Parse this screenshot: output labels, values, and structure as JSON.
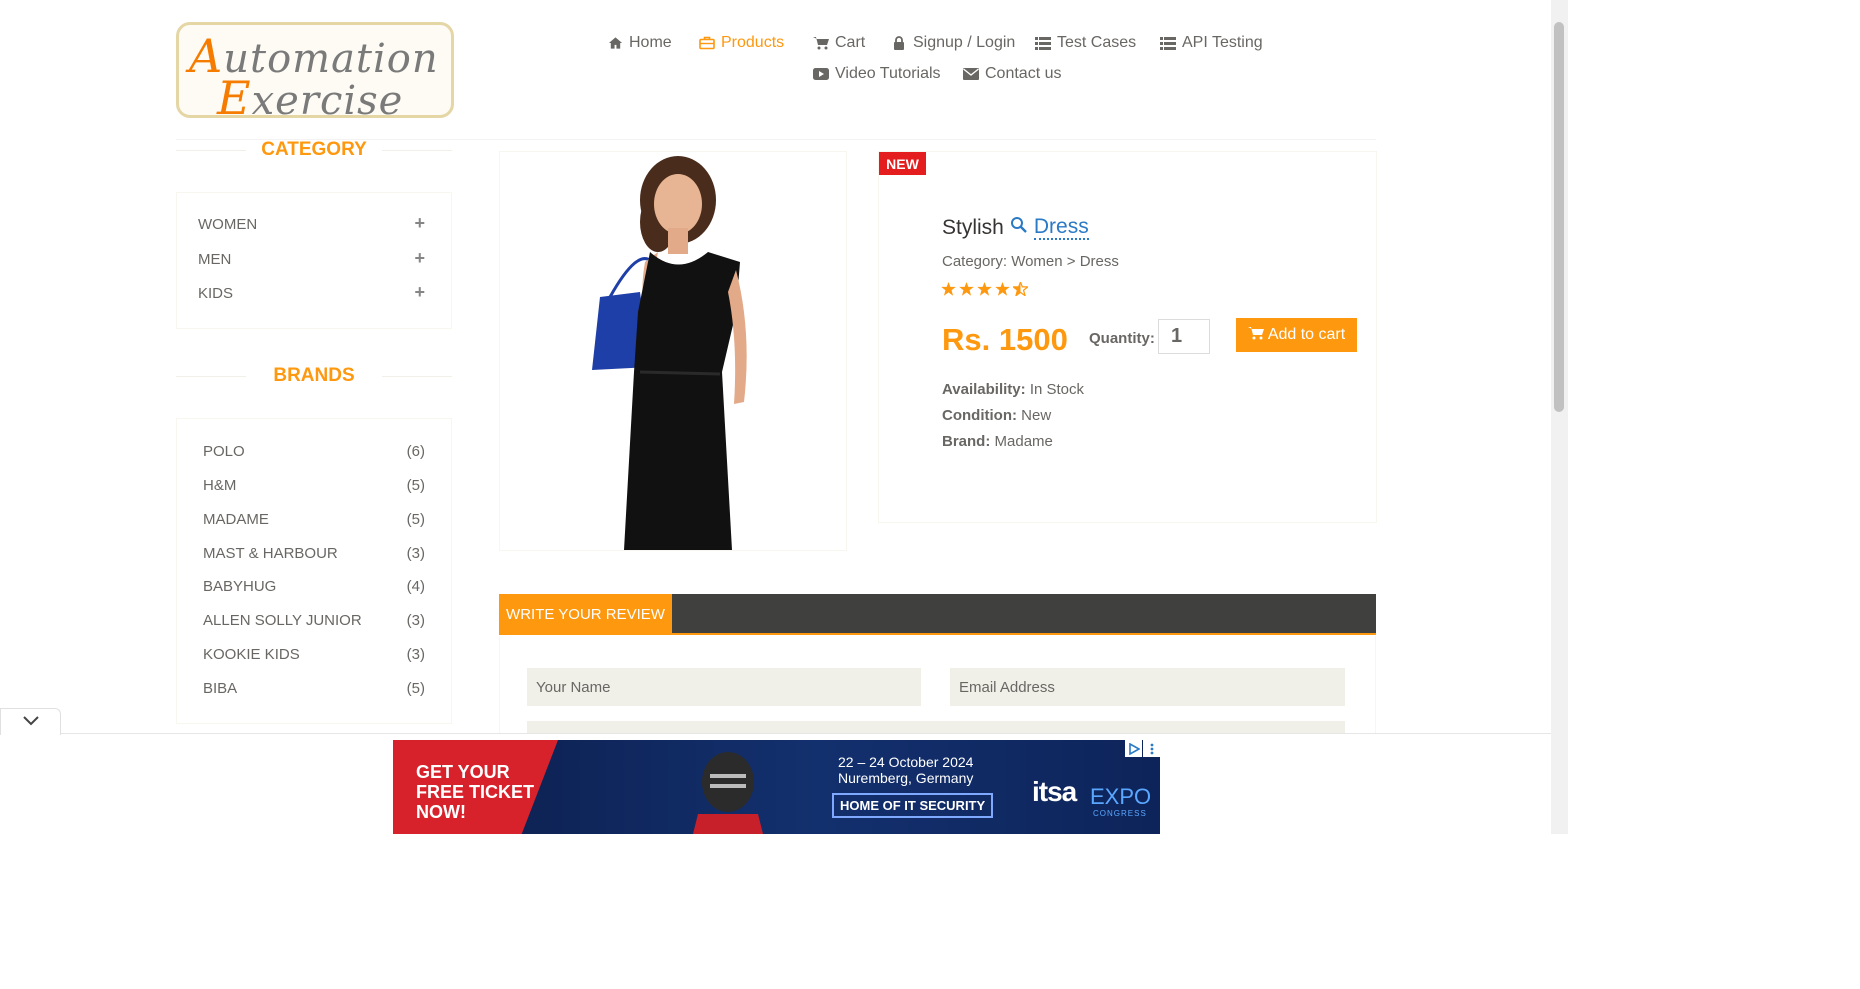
{
  "header": {
    "logo_line1": "Automation",
    "logo_line2": "Exercise",
    "nav": [
      {
        "label": "Home",
        "icon": "home-icon"
      },
      {
        "label": "Products",
        "icon": "briefcase-icon",
        "active": true
      },
      {
        "label": "Cart",
        "icon": "cart-icon"
      },
      {
        "label": "Signup / Login",
        "icon": "lock-icon"
      },
      {
        "label": "Test Cases",
        "icon": "list-icon"
      },
      {
        "label": "API Testing",
        "icon": "list-icon"
      },
      {
        "label": "Video Tutorials",
        "icon": "youtube-icon"
      },
      {
        "label": "Contact us",
        "icon": "envelope-icon"
      }
    ]
  },
  "sidebar": {
    "category_title": "CATEGORY",
    "categories": [
      "WOMEN",
      "MEN",
      "KIDS"
    ],
    "brands_title": "BRANDS",
    "brands": [
      {
        "name": "POLO",
        "count": "(6)"
      },
      {
        "name": "H&M",
        "count": "(5)"
      },
      {
        "name": "MADAME",
        "count": "(5)"
      },
      {
        "name": "MAST & HARBOUR",
        "count": "(3)"
      },
      {
        "name": "BABYHUG",
        "count": "(4)"
      },
      {
        "name": "ALLEN SOLLY JUNIOR",
        "count": "(3)"
      },
      {
        "name": "KOOKIE KIDS",
        "count": "(3)"
      },
      {
        "name": "BIBA",
        "count": "(5)"
      }
    ]
  },
  "product": {
    "badge": "NEW",
    "name_prefix": "Stylish",
    "name_link": "Dress",
    "category": "Category: Women > Dress",
    "rating": 4.5,
    "price": "Rs. 1500",
    "quantity_label": "Quantity:",
    "quantity_value": "1",
    "add_to_cart": "Add to cart",
    "availability_label": "Availability:",
    "availability_value": "In Stock",
    "condition_label": "Condition:",
    "condition_value": "New",
    "brand_label": "Brand:",
    "brand_value": "Madame"
  },
  "review": {
    "tab_label": "WRITE YOUR REVIEW",
    "name_placeholder": "Your Name",
    "email_placeholder": "Email Address"
  },
  "ad": {
    "ticket_line1": "GET YOUR",
    "ticket_line2": "FREE TICKET",
    "ticket_line3": "NOW!",
    "date_line1": "22 – 24 October 2024",
    "date_line2": "Nuremberg, Germany",
    "cta": "HOME OF IT SECURITY",
    "logo_a": "itsa",
    "logo_b": "EXPO",
    "logo_c": "CONGRESS"
  },
  "colors": {
    "accent": "#fe980f",
    "badge_red": "#e41e1e",
    "link_blue": "#2a7ac6",
    "review_bar": "#40403e"
  }
}
